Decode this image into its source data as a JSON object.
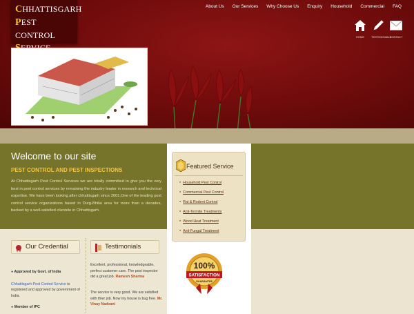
{
  "logo": {
    "lines": [
      {
        "cap": "C",
        "rest": "HHATTISGARH"
      },
      {
        "cap": "P",
        "rest": "EST CONTROL"
      },
      {
        "cap": "S",
        "rest": "ERVICE"
      }
    ]
  },
  "nav": {
    "items": [
      "About Us",
      "Our Services",
      "Why Choose Us",
      "Enquiry",
      "Household",
      "Commercial",
      "FAQ"
    ]
  },
  "icon_buttons": [
    {
      "icon": "home-icon",
      "label": "HOME"
    },
    {
      "icon": "pencil-icon",
      "label": "TESTIMONIALS"
    },
    {
      "icon": "mail-icon",
      "label": "CONTACT"
    }
  ],
  "welcome": {
    "title": "Welcome to our site",
    "subtitle": "PEST CONTROL AND PEST INSPECTIONS",
    "body": "At Chhattisgarh Pest Control Services we are totally committed to give you the very best in pest control services by remaining the industry leader in research and technical expertise. We have been looking after chhattisgarh since 2001.One of the leading pest control service organizations based in Durg-Bhilai area for more than a decades, backed by a well-satisfied clientele in Chhattisgarh."
  },
  "featured": {
    "title": "Featured Service",
    "items": [
      "Household Pest Control",
      "Commercial Pest Control",
      "Rat & Rodent Control",
      "Anti-Termite Treatments",
      "Wood Heat Treatment",
      "Anti-Fungal Treatment"
    ]
  },
  "badge": {
    "top": "100%",
    "middle": "SATISFACTION",
    "bottom": "GUARANTEE"
  },
  "credential": {
    "title": "Our Credential",
    "item1_title": "Approved by Govt. of India",
    "item1_name": "Chhattisgarh Pest Control Service",
    "item1_text": " is registered and approved by government of India.",
    "item2_title": "Member of IPC"
  },
  "testimonials": {
    "title": "Testimonials",
    "t1_text": "Excellent, professional, knowledgeable, perfect customer care. The pest inspector did a great job.",
    "t1_name": "Ramesh Sharma",
    "t2_text": "The service is very good. We are satisfied with thier job. Now my house is bug free.",
    "t2_name": "Mr. Vinay Nadvani"
  }
}
